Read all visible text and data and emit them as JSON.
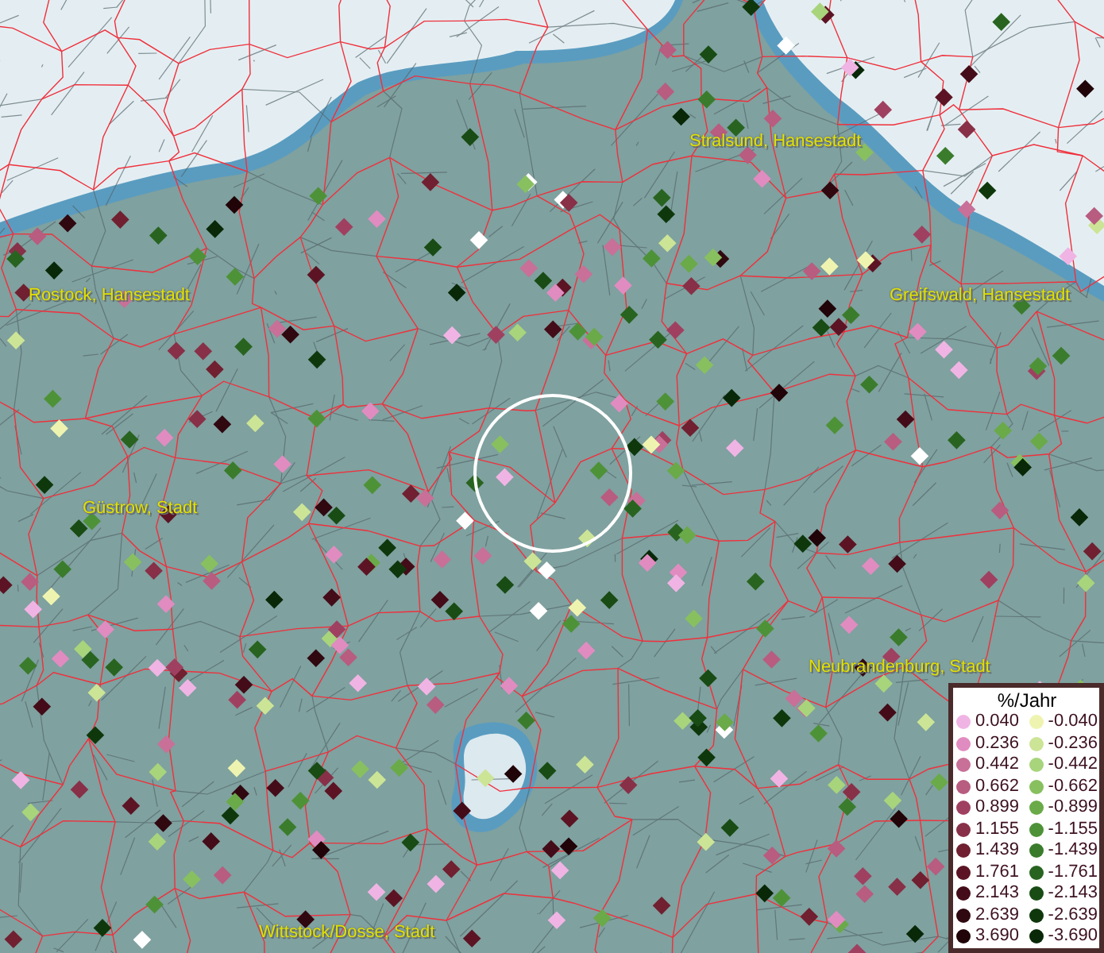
{
  "places": [
    {
      "name": "Stralsund, Hansestadt"
    },
    {
      "name": "Rostock, Hansestadt"
    },
    {
      "name": "Greifswald, Hansestadt"
    },
    {
      "name": "Güstrow, Stadt"
    },
    {
      "name": "Neubrandenburg, Stadt"
    },
    {
      "name": "Wittstock/Dosse, Stadt"
    }
  ],
  "legend": {
    "title": "%/Jahr",
    "positive": [
      {
        "label": "0.040",
        "color": "#f0b4e4"
      },
      {
        "label": "0.236",
        "color": "#e08cc0"
      },
      {
        "label": "0.442",
        "color": "#c87098"
      },
      {
        "label": "0.662",
        "color": "#b85c80"
      },
      {
        "label": "0.899",
        "color": "#a04060"
      },
      {
        "label": "1.155",
        "color": "#883048"
      },
      {
        "label": "1.439",
        "color": "#702030"
      },
      {
        "label": "1.761",
        "color": "#5c1424"
      },
      {
        "label": "2.143",
        "color": "#440c18"
      },
      {
        "label": "2.639",
        "color": "#300810"
      },
      {
        "label": "3.690",
        "color": "#200408"
      }
    ],
    "negative": [
      {
        "label": "-0.040",
        "color": "#eef4b0"
      },
      {
        "label": "-0.236",
        "color": "#cce496"
      },
      {
        "label": "-0.442",
        "color": "#a8d47c"
      },
      {
        "label": "-0.662",
        "color": "#88c060"
      },
      {
        "label": "-0.899",
        "color": "#6aaa48"
      },
      {
        "label": "-1.155",
        "color": "#4e9238"
      },
      {
        "label": "-1.439",
        "color": "#3a7c2c"
      },
      {
        "label": "-1.761",
        "color": "#286420"
      },
      {
        "label": "-2.143",
        "color": "#184c14"
      },
      {
        "label": "-2.639",
        "color": "#0e380c"
      },
      {
        "label": "-3.690",
        "color": "#082808"
      }
    ]
  }
}
